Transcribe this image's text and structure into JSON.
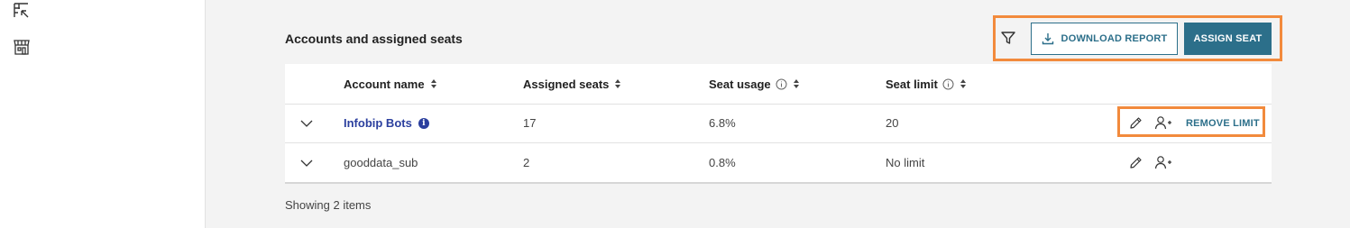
{
  "sidebar": {
    "icons": [
      "table-arrow-icon",
      "storefront-icon"
    ]
  },
  "section": {
    "title": "Accounts and assigned seats"
  },
  "toolbar": {
    "filter_icon": "filter-icon",
    "download_label": "DOWNLOAD REPORT",
    "download_icon": "download-icon",
    "assign_label": "ASSIGN SEAT"
  },
  "table": {
    "columns": {
      "account_name": "Account name",
      "assigned_seats": "Assigned seats",
      "seat_usage": "Seat usage",
      "seat_limit": "Seat limit"
    },
    "rows": [
      {
        "account_name": "Infobip Bots",
        "info_badge": "i",
        "assigned_seats": "17",
        "seat_usage": "6.8%",
        "seat_limit": "20",
        "remove_limit_label": "REMOVE LIMIT"
      },
      {
        "account_name": "gooddata_sub",
        "assigned_seats": "2",
        "seat_usage": "0.8%",
        "seat_limit": "No limit"
      }
    ]
  },
  "footer": {
    "showing": "Showing 2 items"
  },
  "colors": {
    "accent": "#2c6f8a",
    "link": "#2b3f9e",
    "highlight": "#f28a3c"
  }
}
